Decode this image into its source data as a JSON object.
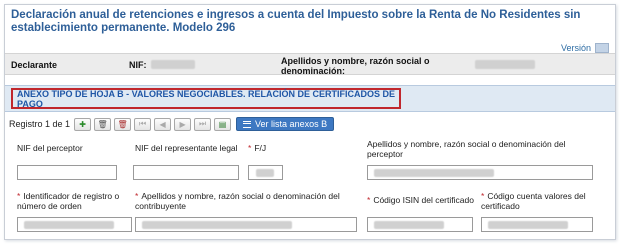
{
  "header": {
    "title": "Declaración anual de retenciones e ingresos a cuenta del Impuesto sobre la Renta de No Residentes sin establecimiento permanente. Modelo 296",
    "version_label": "Versión"
  },
  "declarante": {
    "declarante_label": "Declarante",
    "nif_label": "NIF:",
    "name_label": "Apellidos y nombre, razón social o denominación:"
  },
  "annex": {
    "title": "ANEXO TIPO DE HOJA B - VALORES NEGOCIABLES. RELACIÓN DE CERTIFICADOS DE PAGO"
  },
  "toolbar": {
    "record_label": "Registro 1 de 1",
    "list_button_label": "Ver lista anexos B",
    "icons": [
      "add-record-icon",
      "delete-icon",
      "delete-all-icon",
      "first-icon",
      "previous-icon",
      "next-icon",
      "last-icon",
      "validate-icon",
      "list-icon"
    ]
  },
  "form": {
    "nif_perceptor_label": "NIF del perceptor",
    "nif_representante_label": "NIF del representante legal",
    "fj_label": "F/J",
    "perceptor_name_label": "Apellidos y nombre, razón social o denominación del perceptor",
    "registro_label": "Identificador de registro o número de orden",
    "contribuyente_name_label": "Apellidos y nombre, razón social o denominación del contribuyente",
    "isin_label": "Código ISIN del certificado",
    "cuenta_valores_label": "Código cuenta valores del certificado",
    "required_mark": "*"
  },
  "colors": {
    "title_blue": "#2e5f98",
    "annex_highlight": "#c0272d",
    "annex_bar": "#dfe9f3",
    "button_blue": "#3d78c2"
  }
}
